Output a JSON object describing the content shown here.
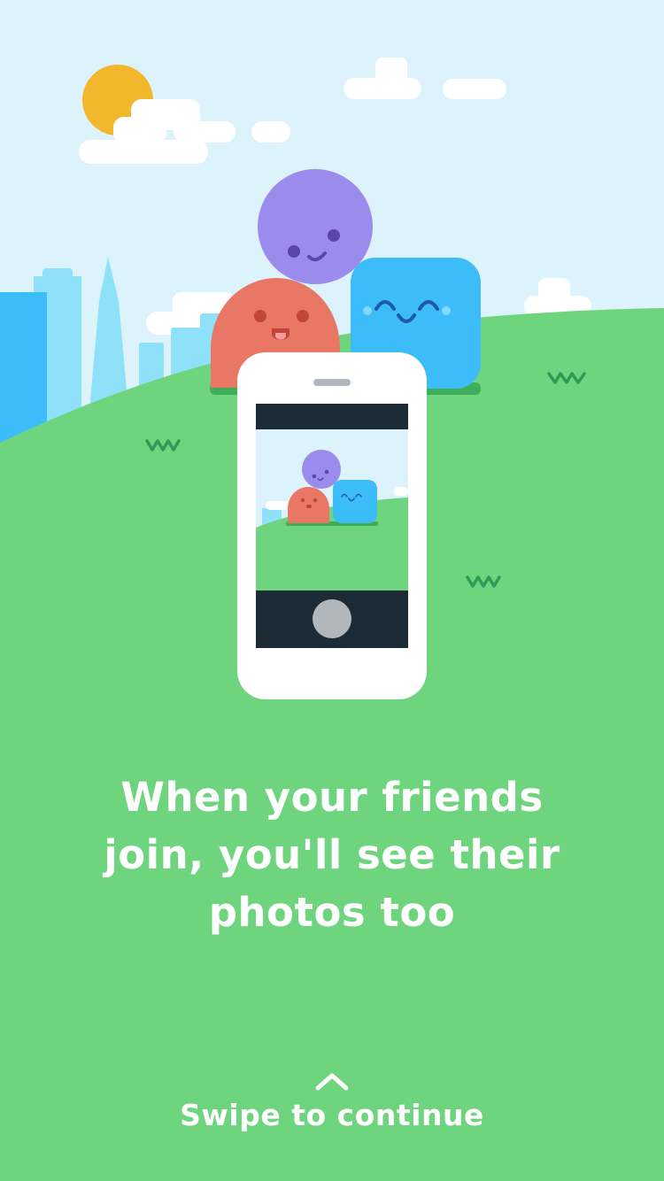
{
  "onboarding": {
    "headline": "When your friends join, you'll see their photos too",
    "swipe_label": "Swipe to continue",
    "swipe_icon": "chevron-up-icon"
  },
  "illustration": {
    "characters": [
      "purple-circle",
      "red-blob",
      "blue-square"
    ],
    "device": "phone-camera",
    "colors": {
      "sky": "#dcf3fc",
      "grass": "#6ed47e",
      "grass_dark": "#3fae5b",
      "sun": "#f2b72c",
      "purple": "#9b8bec",
      "red": "#e87865",
      "blue": "#3cbcf8",
      "phone_dark": "#1d2b36",
      "shutter": "#b0b7bd"
    }
  }
}
